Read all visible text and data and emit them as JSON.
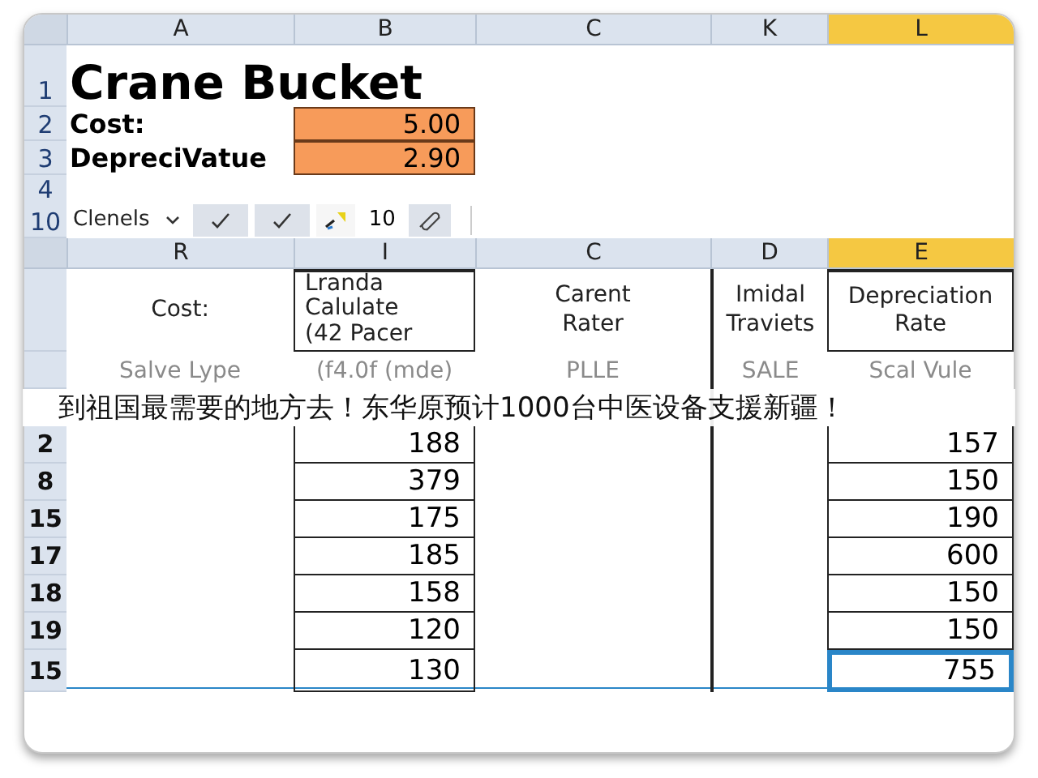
{
  "top_columns": [
    {
      "label": "A",
      "selected": false
    },
    {
      "label": "B",
      "selected": false
    },
    {
      "label": "C",
      "selected": false
    },
    {
      "label": "K",
      "selected": false
    },
    {
      "label": "L",
      "selected": true
    }
  ],
  "title": {
    "row": "1",
    "text": "Crane Bucket"
  },
  "fields": [
    {
      "row": "2",
      "label": "Cost:",
      "value": "5.00"
    },
    {
      "row": "3",
      "label": "DepreciVatue",
      "value": "2.90"
    }
  ],
  "blank_row": "4",
  "toolbar": {
    "row": "10",
    "dropdown": "Clenels",
    "count": "10"
  },
  "table_columns": [
    {
      "label": "R",
      "selected": false
    },
    {
      "label": "I",
      "selected": false
    },
    {
      "label": "C",
      "selected": false
    },
    {
      "label": "D",
      "selected": false
    },
    {
      "label": "E",
      "selected": true
    }
  ],
  "table_header": [
    "Cost:",
    "Lranda\nCalulate\n(42 Pacer",
    "Carent\nRater",
    "Imidal\nTraviets",
    "Depreciation\nRate"
  ],
  "sub_header": [
    "Salve Lype",
    "(f4.0f (mde)",
    "PLLE",
    "SALE",
    "Scal Vule"
  ],
  "rows": [
    {
      "header": "2",
      "col_i": "188",
      "col_e": "157",
      "selected": false
    },
    {
      "header": "8",
      "col_i": "379",
      "col_e": "150",
      "selected": false
    },
    {
      "header": "15",
      "col_i": "175",
      "col_e": "190",
      "selected": false
    },
    {
      "header": "17",
      "col_i": "185",
      "col_e": "600",
      "selected": false
    },
    {
      "header": "18",
      "col_i": "158",
      "col_e": "150",
      "selected": false
    },
    {
      "header": "19",
      "col_i": "120",
      "col_e": "150",
      "selected": false
    },
    {
      "header": "15",
      "col_i": "130",
      "col_e": "755",
      "selected": true
    }
  ],
  "banner": "到祖国最需要的地方去！东华原预计1000台中医设备支援新疆！"
}
